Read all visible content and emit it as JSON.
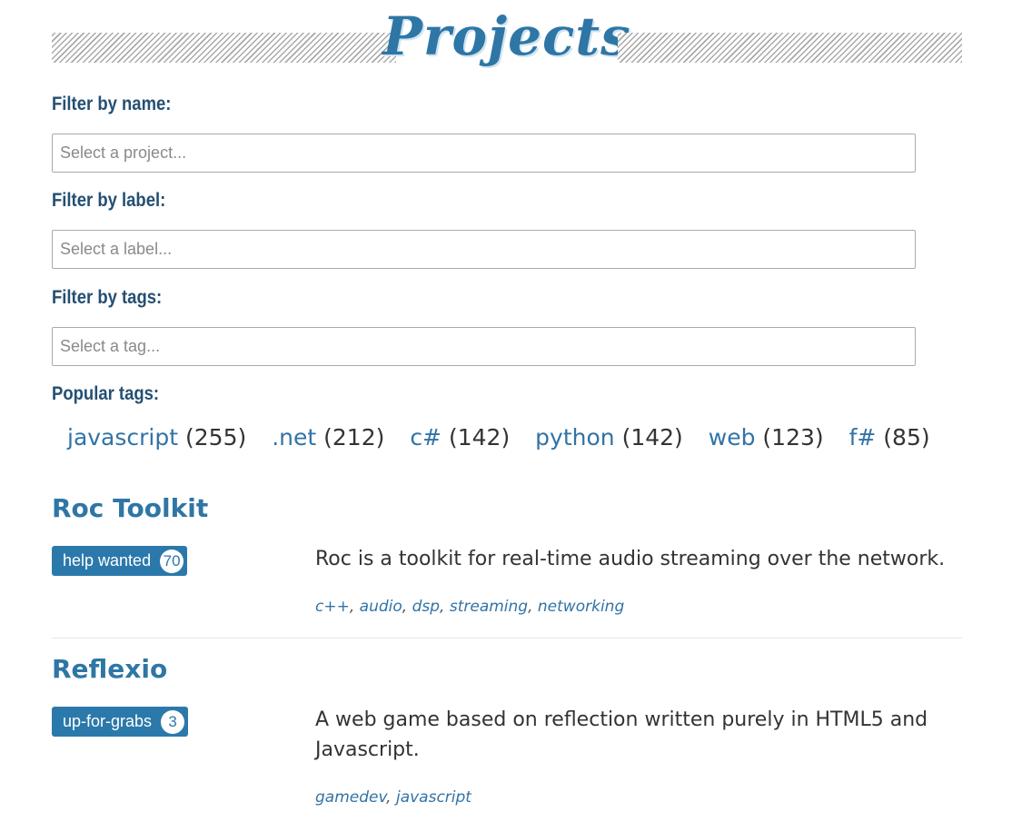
{
  "header": {
    "title": "Projects"
  },
  "filters": {
    "name": {
      "label": "Filter by name:",
      "placeholder": "Select a project..."
    },
    "label": {
      "label": "Filter by label:",
      "placeholder": "Select a label..."
    },
    "tags": {
      "label": "Filter by tags:",
      "placeholder": "Select a tag..."
    }
  },
  "popular_tags": {
    "label": "Popular tags:",
    "items": [
      {
        "name": "javascript",
        "count": "(255)"
      },
      {
        "name": ".net",
        "count": "(212)"
      },
      {
        "name": "c#",
        "count": "(142)"
      },
      {
        "name": "python",
        "count": "(142)"
      },
      {
        "name": "web",
        "count": "(123)"
      },
      {
        "name": "f#",
        "count": "(85)"
      }
    ]
  },
  "projects": [
    {
      "name": "Roc Toolkit",
      "label": "help wanted",
      "label_count": "70",
      "description": "Roc is a toolkit for real-time audio streaming over the network.",
      "tags": [
        "c++",
        "audio",
        "dsp",
        "streaming",
        "networking"
      ]
    },
    {
      "name": "Reflexio",
      "label": "up-for-grabs",
      "label_count": "3",
      "description": "A web game based on reflection written purely in HTML5 and Javascript.",
      "tags": [
        "gamedev",
        "javascript"
      ]
    }
  ],
  "colors": {
    "accent": "#2e76a6",
    "badge": "#2b79ab",
    "label_text": "#244f72"
  }
}
